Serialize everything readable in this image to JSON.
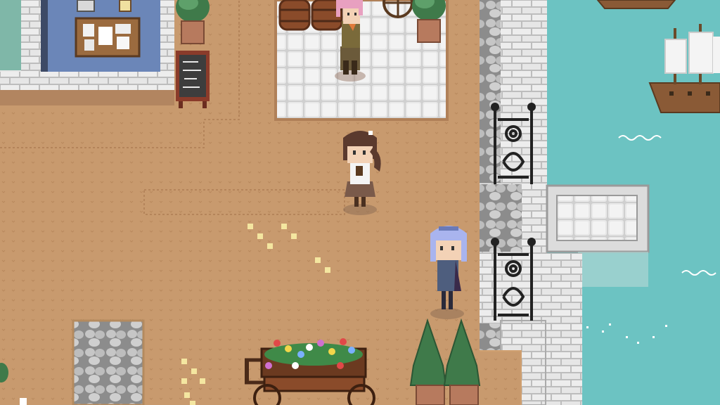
{
  "scene": {
    "type": "pixel-art town harbor",
    "colors": {
      "dirt": "#c89a6e",
      "dirt_dark": "#b98a5f",
      "water": "#6cc3c2",
      "stone_light": "#e6e6e6",
      "stone_mid": "#c9c9c9",
      "stone_dark": "#8f8f8f",
      "wall_blue": "#6b86b8",
      "wood": "#8a4b2a",
      "leaf": "#3f7a4a",
      "flower_yellow": "#f4e6a0"
    },
    "characters": [
      {
        "name": "pink-haired-villager",
        "hair": "#e8a0c0"
      },
      {
        "name": "brown-haired-girl",
        "hair": "#5b3a2e"
      },
      {
        "name": "lavender-haired-villager",
        "hair": "#a9b4ee"
      }
    ],
    "objects": [
      "notice-board",
      "chalkboard-sign",
      "wooden-barrels",
      "potted-topiaries",
      "flower-cart",
      "iron-gates",
      "sailing-ships",
      "stone-pier"
    ]
  }
}
